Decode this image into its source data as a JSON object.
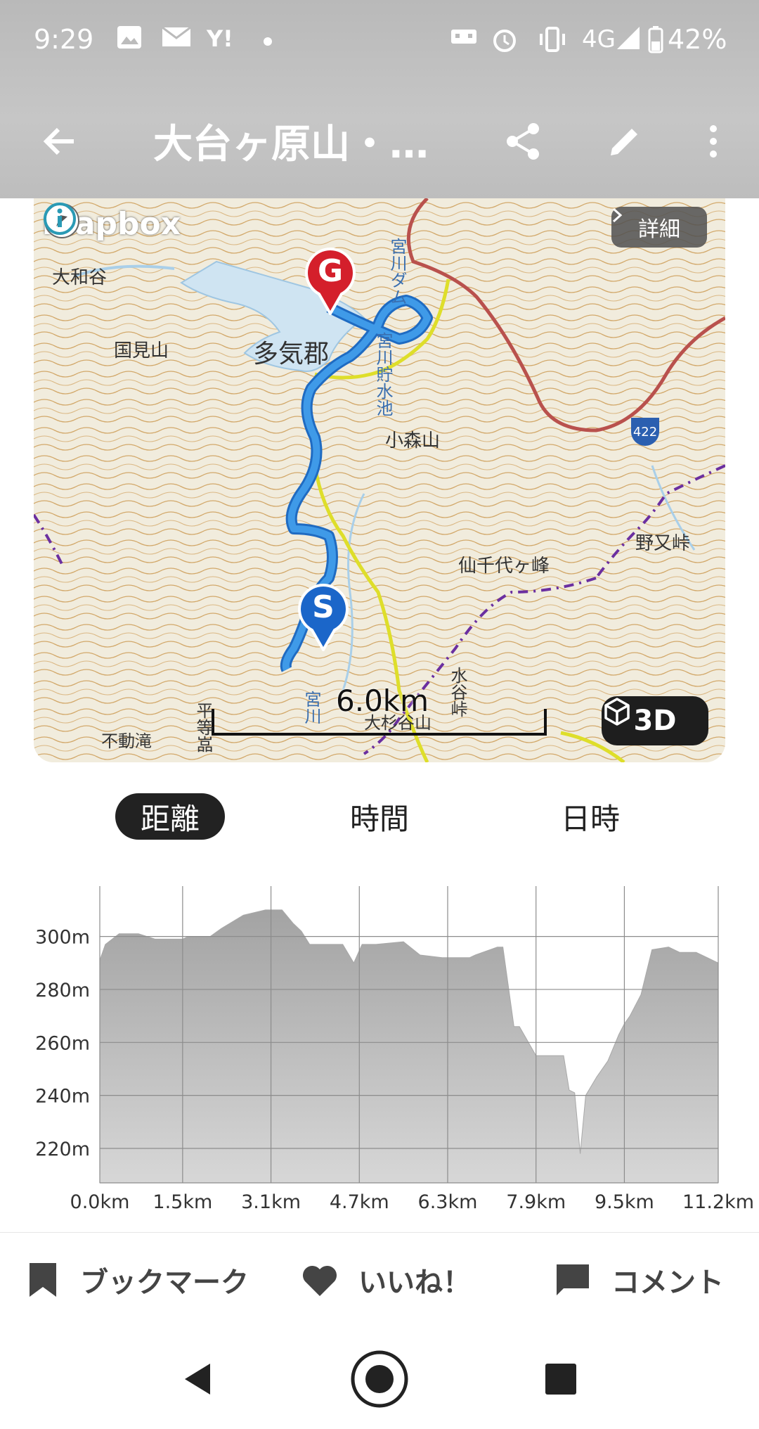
{
  "status_bar": {
    "time": "9:29",
    "network": "4G",
    "battery": "42%",
    "icons": [
      "photo-icon",
      "mail-icon",
      "yahoo-icon",
      "dot-icon",
      "alarm-icon",
      "vibrate-icon",
      "signal-icon",
      "battery-icon"
    ]
  },
  "app_bar": {
    "title": "大台ヶ原山・…",
    "icons": [
      "back-arrow-icon",
      "share-icon",
      "edit-icon",
      "more-vert-icon"
    ]
  },
  "map": {
    "logo_text": "mapbox",
    "detail_button": "詳細",
    "button_3d": "3D",
    "scale_label": "6.0km",
    "start_marker": "S",
    "goal_marker": "G",
    "route_shield": "422",
    "place_labels": [
      "大和谷",
      "国見山",
      "多気郡",
      "宮川ダム",
      "宮川貯水池",
      "小森山",
      "仙千代ヶ峰",
      "野又峠",
      "水谷峠",
      "平等嵓",
      "不動滝",
      "宮川",
      "大杉谷山"
    ],
    "colors": {
      "route": "#2f8fe0",
      "water": "#cfe4f2",
      "contour": "#c79a55",
      "trail": "#dede2a"
    }
  },
  "tabs": [
    {
      "label": "距離",
      "active": true
    },
    {
      "label": "時間",
      "active": false
    },
    {
      "label": "日時",
      "active": false
    }
  ],
  "chart_data": {
    "type": "area",
    "xlabel": "",
    "ylabel": "",
    "x_tick_labels": [
      "0.0km",
      "1.5km",
      "3.1km",
      "4.7km",
      "6.3km",
      "7.9km",
      "9.5km",
      "11.2km"
    ],
    "y_tick_labels": [
      "220m",
      "240m",
      "260m",
      "280m",
      "300m"
    ],
    "y_ticks": [
      220,
      240,
      260,
      280,
      300
    ],
    "x_ticks": [
      0.0,
      1.5,
      3.1,
      4.7,
      6.3,
      7.9,
      9.5,
      11.2
    ],
    "xlim": [
      0,
      11.2
    ],
    "ylim": [
      207,
      319
    ],
    "grid": true,
    "series": [
      {
        "x": [
          0.0,
          0.1,
          0.35,
          0.7,
          1.0,
          1.5,
          1.6,
          2.0,
          2.2,
          2.6,
          3.0,
          3.3,
          3.5,
          3.65,
          3.8,
          4.4,
          4.6,
          4.75,
          5.0,
          5.5,
          5.8,
          6.2,
          6.7,
          6.8,
          7.2,
          7.3,
          7.5,
          7.6,
          7.9,
          8.4,
          8.5,
          8.6,
          8.7,
          8.8,
          9.0,
          9.2,
          9.4,
          9.5,
          9.6,
          9.8,
          10.0,
          10.3,
          10.5,
          10.8,
          11.0,
          11.2
        ],
        "y": [
          291,
          297,
          301,
          301,
          299,
          299,
          300,
          300,
          303,
          308,
          310,
          310,
          305,
          302,
          297,
          297,
          290,
          297,
          297,
          298,
          293,
          292,
          292,
          293,
          296,
          296,
          266,
          266,
          255,
          255,
          242,
          241,
          218,
          240,
          247,
          253,
          263,
          267,
          270,
          278,
          295,
          296,
          294,
          294,
          292,
          290
        ]
      }
    ],
    "fill_color": "#a8a8a8"
  },
  "actions": [
    {
      "label": "ブックマーク",
      "icon": "bookmark-icon"
    },
    {
      "label": "いいね！",
      "icon": "heart-icon"
    },
    {
      "label": "コメント",
      "icon": "comment-icon"
    }
  ],
  "nav_bar": {
    "icons": [
      "nav-back-icon",
      "nav-home-icon",
      "nav-recents-icon"
    ]
  }
}
